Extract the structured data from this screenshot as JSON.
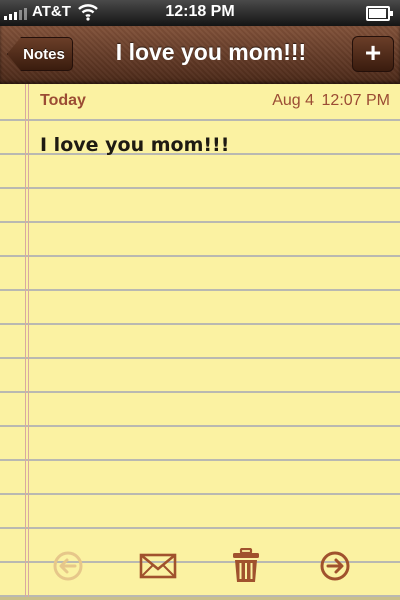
{
  "status_bar": {
    "carrier": "AT&T",
    "time": "12:18 PM",
    "icons": [
      "signal-bars-icon",
      "wifi-icon",
      "battery-icon"
    ],
    "battery_level_percent": 100
  },
  "nav": {
    "back_label": "Notes",
    "title": "I love you mom!!!",
    "add_label": "+"
  },
  "note": {
    "date_label": "Today",
    "date": "Aug 4",
    "time": "12:07 PM",
    "body": "I love you mom!!!"
  },
  "toolbar": {
    "icons": [
      "previous-arrow-icon",
      "mail-icon",
      "trash-icon",
      "next-arrow-icon"
    ],
    "previous_enabled": false
  },
  "colors": {
    "paper": "#fbf2a2",
    "accent": "#9b4c34",
    "leather": "#6a3e28"
  }
}
